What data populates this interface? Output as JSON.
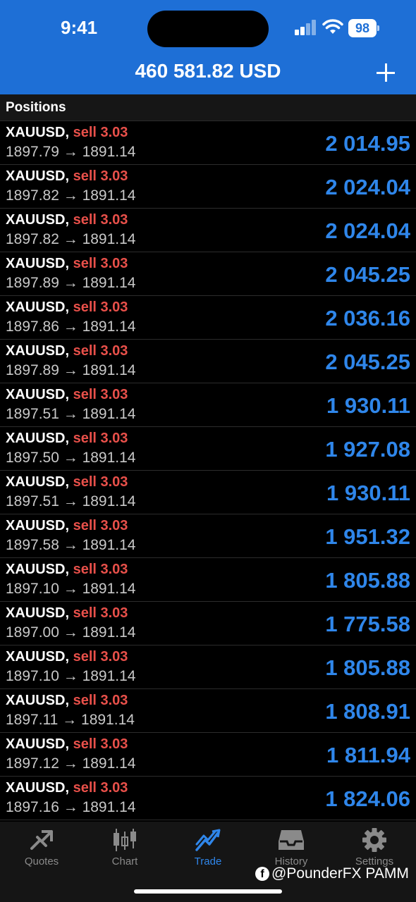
{
  "status_bar": {
    "time": "9:41",
    "battery": "98"
  },
  "header": {
    "balance": "460 581.82 USD"
  },
  "section": {
    "title": "Positions"
  },
  "positions": [
    {
      "symbol": "XAUUSD,",
      "side": "sell 3.03",
      "prices": "1897.79 → 1891.14",
      "profit": "2 014.95"
    },
    {
      "symbol": "XAUUSD,",
      "side": "sell 3.03",
      "prices": "1897.82 → 1891.14",
      "profit": "2 024.04"
    },
    {
      "symbol": "XAUUSD,",
      "side": "sell 3.03",
      "prices": "1897.82 → 1891.14",
      "profit": "2 024.04"
    },
    {
      "symbol": "XAUUSD,",
      "side": "sell 3.03",
      "prices": "1897.89 → 1891.14",
      "profit": "2 045.25"
    },
    {
      "symbol": "XAUUSD,",
      "side": "sell 3.03",
      "prices": "1897.86 → 1891.14",
      "profit": "2 036.16"
    },
    {
      "symbol": "XAUUSD,",
      "side": "sell 3.03",
      "prices": "1897.89 → 1891.14",
      "profit": "2 045.25"
    },
    {
      "symbol": "XAUUSD,",
      "side": "sell 3.03",
      "prices": "1897.51 → 1891.14",
      "profit": "1 930.11"
    },
    {
      "symbol": "XAUUSD,",
      "side": "sell 3.03",
      "prices": "1897.50 → 1891.14",
      "profit": "1 927.08"
    },
    {
      "symbol": "XAUUSD,",
      "side": "sell 3.03",
      "prices": "1897.51 → 1891.14",
      "profit": "1 930.11"
    },
    {
      "symbol": "XAUUSD,",
      "side": "sell 3.03",
      "prices": "1897.58 → 1891.14",
      "profit": "1 951.32"
    },
    {
      "symbol": "XAUUSD,",
      "side": "sell 3.03",
      "prices": "1897.10 → 1891.14",
      "profit": "1 805.88"
    },
    {
      "symbol": "XAUUSD,",
      "side": "sell 3.03",
      "prices": "1897.00 → 1891.14",
      "profit": "1 775.58"
    },
    {
      "symbol": "XAUUSD,",
      "side": "sell 3.03",
      "prices": "1897.10 → 1891.14",
      "profit": "1 805.88"
    },
    {
      "symbol": "XAUUSD,",
      "side": "sell 3.03",
      "prices": "1897.11 → 1891.14",
      "profit": "1 808.91"
    },
    {
      "symbol": "XAUUSD,",
      "side": "sell 3.03",
      "prices": "1897.12 → 1891.14",
      "profit": "1 811.94"
    },
    {
      "symbol": "XAUUSD,",
      "side": "sell 3.03",
      "prices": "1897.16 → 1891.14",
      "profit": "1 824.06"
    }
  ],
  "tabs": [
    {
      "label": "Quotes",
      "icon": "quotes-icon",
      "active": false
    },
    {
      "label": "Chart",
      "icon": "chart-icon",
      "active": false
    },
    {
      "label": "Trade",
      "icon": "trade-icon",
      "active": true
    },
    {
      "label": "History",
      "icon": "history-icon",
      "active": false
    },
    {
      "label": "Settings",
      "icon": "settings-icon",
      "active": false
    }
  ],
  "watermark": {
    "icon": "facebook-icon",
    "text": "@PounderFX PAMM"
  },
  "colors": {
    "header": "#1e6fd6",
    "sell": "#e8504a",
    "profit": "#2f86ea",
    "tab_active": "#2f86ea",
    "tab_inactive": "#8a8a8a"
  }
}
